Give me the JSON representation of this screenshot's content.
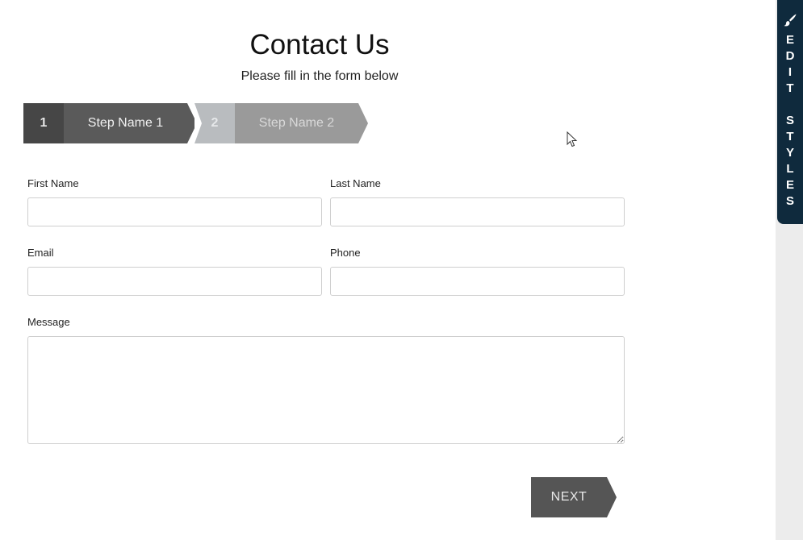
{
  "header": {
    "title": "Contact Us",
    "subtitle": "Please fill in the form below"
  },
  "steps": [
    {
      "number": "1",
      "label": "Step Name 1",
      "state": "active"
    },
    {
      "number": "2",
      "label": "Step Name 2",
      "state": "inactive"
    }
  ],
  "form": {
    "first_name": {
      "label": "First Name",
      "value": "",
      "placeholder": ""
    },
    "last_name": {
      "label": "Last Name",
      "value": "",
      "placeholder": ""
    },
    "email": {
      "label": "Email",
      "value": "",
      "placeholder": ""
    },
    "phone": {
      "label": "Phone",
      "value": "",
      "placeholder": ""
    },
    "message": {
      "label": "Message",
      "value": "",
      "placeholder": ""
    },
    "next_label": "NEXT"
  },
  "sidebar": {
    "edit_styles_letters": [
      "E",
      "D",
      "I",
      "T",
      "",
      "S",
      "T",
      "Y",
      "L",
      "E",
      "S"
    ],
    "icon": "paintbrush-icon"
  },
  "colors": {
    "step_active": "#5a5a5a",
    "step_inactive": "#9a9a9a",
    "next_button": "#555555",
    "edit_styles_tab": "#0f2a3d"
  }
}
